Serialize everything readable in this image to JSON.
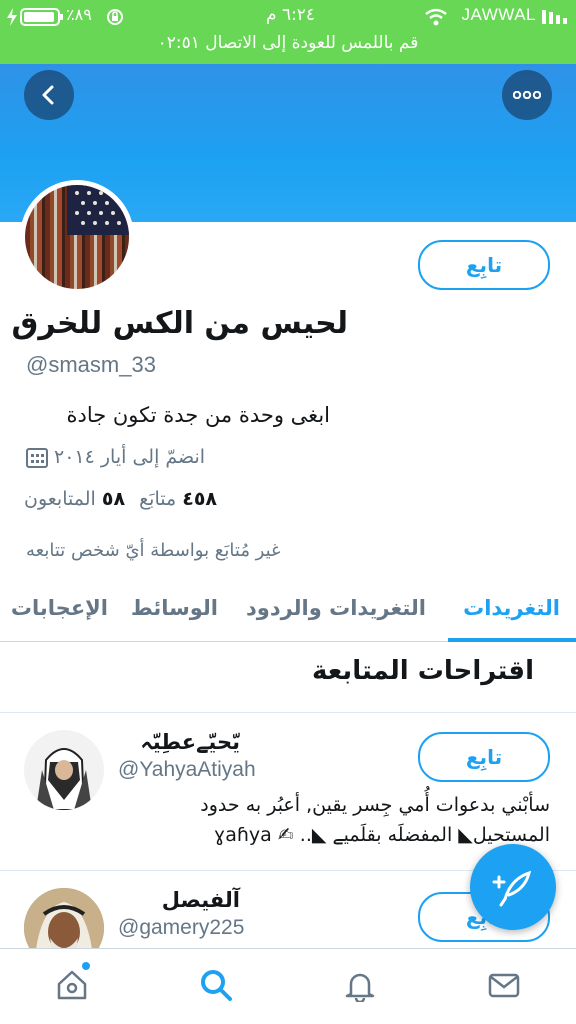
{
  "status_bar": {
    "carrier": "JAWWAL",
    "time": "٦:٢٤ م",
    "battery_percent": "٪٨٩",
    "banner": "قم باللمس للعودة إلى الاتصال ٠٢:٥١",
    "background": "#68d755"
  },
  "profile": {
    "name": "لحيس من الكس للخرق",
    "handle": "@smasm_33",
    "bio": "ابغى وحدة من جدة تكون جادة",
    "joined": "انضمّ إلى أيار ٢٠١٤",
    "following_count": "٤٥٨",
    "following_label": "متابَع",
    "followers_count": "٥٨",
    "followers_label": "المتابعون",
    "note": "غير مُتابَع بواسطة أيّ شخص تتابعه",
    "follow_label": "تابِع"
  },
  "tabs": [
    {
      "label": "التغريدات",
      "active": true
    },
    {
      "label": "التغريدات والردود",
      "active": false
    },
    {
      "label": "الوسائط",
      "active": false
    },
    {
      "label": "الإعجابات",
      "active": false
    }
  ],
  "suggestions": {
    "title": "اقتراحات المتابعة",
    "items": [
      {
        "name": "يّحيّےعطِيّہ",
        "handle": "@YahyaAtiyah",
        "bio_line1": "سأبْني بدعوات أُمي جِسر يقين, أعبُر به حدود",
        "bio_line2": "المستحيل◣ المفضلَه بقلَميے ◣.. ✍ ɣaɦya",
        "follow_label": "تابِع"
      },
      {
        "name": "آلفيصل",
        "handle": "@gamery225",
        "follow_label": "تابِع"
      }
    ]
  },
  "icons": {
    "back": "chevron-left-icon",
    "more": "more-dots-icon",
    "compose": "compose-feather-icon",
    "home": "home-icon",
    "search": "search-icon",
    "notifications": "bell-icon",
    "messages": "mail-icon"
  },
  "colors": {
    "accent": "#1da1f2",
    "muted": "#657786"
  }
}
